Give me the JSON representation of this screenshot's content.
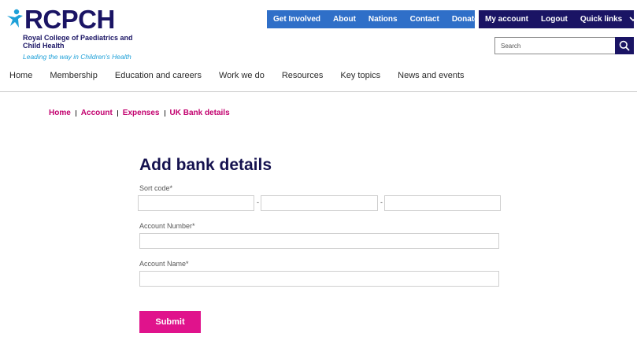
{
  "logo": {
    "wordmark": "RCPCH",
    "org_name": "Royal College of Paediatrics and Child Health",
    "tagline": "Leading the way in Children's Health"
  },
  "top_nav": {
    "primary": [
      "Get Involved",
      "About",
      "Nations",
      "Contact",
      "Donate"
    ],
    "account": [
      "My account",
      "Logout"
    ],
    "quick_links": "Quick links"
  },
  "search": {
    "placeholder": "Search"
  },
  "main_nav": [
    "Home",
    "Membership",
    "Education and careers",
    "Work we do",
    "Resources",
    "Key topics",
    "News and events"
  ],
  "breadcrumb": [
    "Home",
    "Account",
    "Expenses",
    "UK Bank details"
  ],
  "form": {
    "title": "Add bank details",
    "sort_code_label": "Sort code*",
    "sort_code_separator": "-",
    "account_number_label": "Account Number*",
    "account_name_label": "Account Name*",
    "submit_label": "Submit"
  },
  "colors": {
    "brand_navy": "#1a1464",
    "nav_blue": "#2f6fc8",
    "breadcrumb_pink": "#c2006e",
    "submit_pink": "#e0138c",
    "tagline_blue": "#1ea0d8"
  }
}
